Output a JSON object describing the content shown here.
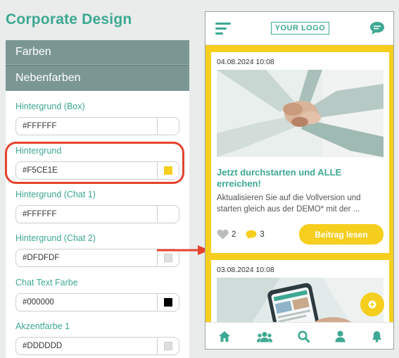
{
  "page_title": "Corporate Design",
  "sections": [
    {
      "label": "Farben"
    },
    {
      "label": "Nebenfarben"
    }
  ],
  "fields": [
    {
      "label": "Hintergrund (Box)",
      "value": "#FFFFFF",
      "swatch": ""
    },
    {
      "label": "Hintergrund",
      "value": "#F5CE1E",
      "swatch": "#F5CE1E"
    },
    {
      "label": "Hintergrund (Chat 1)",
      "value": "#FFFFFF",
      "swatch": ""
    },
    {
      "label": "Hintergrund (Chat 2)",
      "value": "#DFDFDF",
      "swatch": "#DFDFDF"
    },
    {
      "label": "Chat Text Farbe",
      "value": "#000000",
      "swatch": "#000000"
    },
    {
      "label": "Akzentfarbe 1",
      "value": "#DDDDDD",
      "swatch": "#DDDDDD"
    }
  ],
  "colors": {
    "accent": "#3da892",
    "highlight": "#e5432f",
    "yellow": "#F5CE1E",
    "panel_header": "#7a9794"
  },
  "preview": {
    "logo": "YOUR LOGO",
    "post1": {
      "date": "04.08.2024 10:08",
      "title": "Jetzt durchstarten und ALLE erreichen!",
      "excerpt": "Aktualisieren Sie auf die Vollversion und starten gleich aus der DEMO* mit der ...",
      "likes": "2",
      "comments": "3",
      "button": "Beitrag lesen"
    },
    "post2": {
      "date": "03.08.2024 10:08"
    },
    "nav_icons": [
      "home-icon",
      "group-icon",
      "search-icon",
      "user-icon",
      "bell-icon"
    ]
  }
}
